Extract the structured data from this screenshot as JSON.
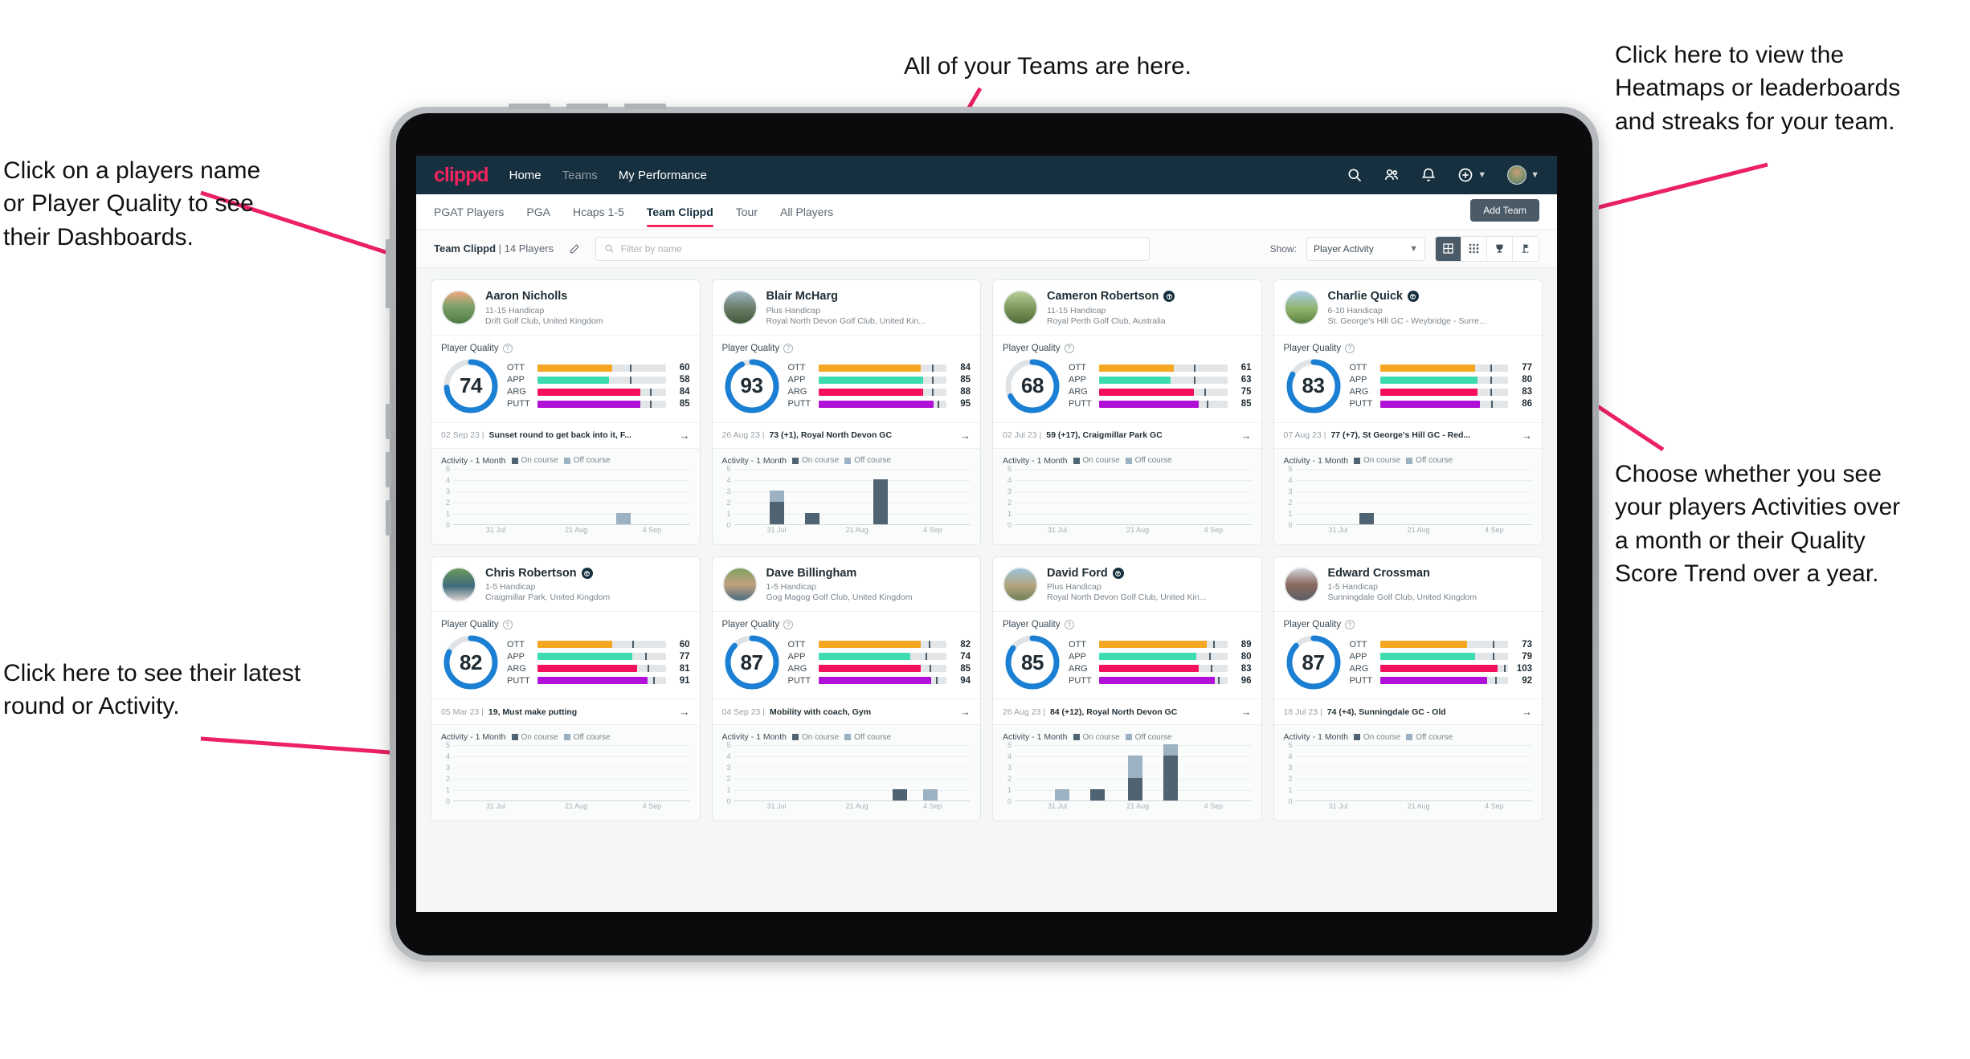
{
  "annotations": [
    {
      "id": "teams",
      "text": "All of your Teams are here."
    },
    {
      "id": "heatmaps",
      "text": "Click here to view the\nHeatmaps or leaderboards\nand streaks for your team."
    },
    {
      "id": "player-name",
      "text": "Click on a players name\nor Player Quality to see\ntheir Dashboards."
    },
    {
      "id": "show-toggle",
      "text": "Choose whether you see\nyour players Activities over\na month or their Quality\nScore Trend over a year."
    },
    {
      "id": "latest-round",
      "text": "Click here to see their latest\nround or Activity."
    }
  ],
  "colors": {
    "brand_pink": "#f0245f",
    "nav_dark": "#16303f",
    "ott": "#f5a623",
    "app": "#3ddbb0",
    "arg": "#f5105e",
    "putt": "#b110d6",
    "donut": "#1b7fd4",
    "donut_track": "#dfe3e6",
    "on_course": "#4f6373",
    "off_course": "#9cb1c2"
  },
  "topnav": {
    "logo": "clippd",
    "links": [
      {
        "label": "Home",
        "active": true
      },
      {
        "label": "Teams",
        "active": false
      },
      {
        "label": "My Performance",
        "active": true
      }
    ],
    "icons": [
      "search-icon",
      "people-icon",
      "bell-icon",
      "plus-circle-icon",
      "avatar"
    ]
  },
  "tabs": [
    {
      "label": "PGAT Players",
      "active": false
    },
    {
      "label": "PGA",
      "active": false
    },
    {
      "label": "Hcaps 1-5",
      "active": false
    },
    {
      "label": "Team Clippd",
      "active": true
    },
    {
      "label": "Tour",
      "active": false
    },
    {
      "label": "All Players",
      "active": false
    }
  ],
  "add_team_label": "Add Team",
  "filterbar": {
    "team_name": "Team Clippd",
    "player_count": "| 14 Players",
    "edit_icon": "pencil-icon",
    "search_placeholder": "Filter by name",
    "search_value": "",
    "show_label": "Show:",
    "show_value": "Player Activity",
    "show_options": [
      "Player Activity",
      "Quality Score Trend"
    ],
    "view_buttons": [
      {
        "name": "grid-view",
        "active": true
      },
      {
        "name": "dense-grid-view",
        "active": false
      },
      {
        "name": "leaderboard-trophy-view",
        "active": false
      },
      {
        "name": "streaks-flag-view",
        "active": false
      }
    ]
  },
  "card_labels": {
    "player_quality": "Player Quality",
    "activity": "Activity - 1 Month",
    "legend_on": "On course",
    "legend_off": "Off course",
    "metric_names": [
      "OTT",
      "APP",
      "ARG",
      "PUTT"
    ]
  },
  "chart_data": {
    "type": "bar",
    "title": "Activity - 1 Month",
    "ylabel": "",
    "xlabel": "",
    "ylim": [
      0,
      5
    ],
    "yticks": [
      0,
      1,
      2,
      3,
      4,
      5
    ],
    "xticks": [
      "31 Jul",
      "21 Aug",
      "4 Sep"
    ],
    "grid": true,
    "legend": [
      "On course",
      "Off course"
    ],
    "stacked": true
  },
  "players": [
    {
      "name": "Aaron Nicholls",
      "verified": false,
      "handicap": "11-15 Handicap",
      "club": "Drift Golf Club, United Kingdom",
      "avatar_css": "linear-gradient(180deg,#f0a884 0%,#7fa36a 45%,#4e7a45 100%)",
      "quality": 74,
      "metrics": [
        {
          "key": "OTT",
          "value": 60,
          "fill": 58,
          "tick": 72
        },
        {
          "key": "APP",
          "value": 58,
          "fill": 56,
          "tick": 72
        },
        {
          "key": "ARG",
          "value": 84,
          "fill": 80,
          "tick": 88
        },
        {
          "key": "PUTT",
          "value": 85,
          "fill": 80,
          "tick": 88
        }
      ],
      "round_date": "02 Sep 23 |",
      "round_text": "Sunset round to get back into it, F...",
      "activity": [
        {
          "x": 0.72,
          "on": 0,
          "off": 1
        }
      ]
    },
    {
      "name": "Blair McHarg",
      "verified": false,
      "handicap": "Plus Handicap",
      "club": "Royal North Devon Golf Club, United Kin...",
      "avatar_css": "linear-gradient(180deg,#9fb6c6 0%,#6d7f6a 50%,#3f5a3a 100%)",
      "quality": 93,
      "metrics": [
        {
          "key": "OTT",
          "value": 84,
          "fill": 80,
          "tick": 89
        },
        {
          "key": "APP",
          "value": 85,
          "fill": 82,
          "tick": 89
        },
        {
          "key": "ARG",
          "value": 88,
          "fill": 82,
          "tick": 89
        },
        {
          "key": "PUTT",
          "value": 95,
          "fill": 90,
          "tick": 93
        }
      ],
      "round_date": "26 Aug 23 |",
      "round_text": "73 (+1), Royal North Devon GC",
      "activity": [
        {
          "x": 0.18,
          "on": 2,
          "off": 1
        },
        {
          "x": 0.33,
          "on": 1,
          "off": 0
        },
        {
          "x": 0.62,
          "on": 4,
          "off": 0
        }
      ]
    },
    {
      "name": "Cameron Robertson",
      "verified": true,
      "handicap": "11-15 Handicap",
      "club": "Royal Perth Golf Club, Australia",
      "avatar_css": "linear-gradient(180deg,#b9cf9a 0%,#7e9a5c 50%,#4f6b3a 100%)",
      "quality": 68,
      "metrics": [
        {
          "key": "OTT",
          "value": 61,
          "fill": 58,
          "tick": 74
        },
        {
          "key": "APP",
          "value": 63,
          "fill": 56,
          "tick": 74
        },
        {
          "key": "ARG",
          "value": 75,
          "fill": 74,
          "tick": 82
        },
        {
          "key": "PUTT",
          "value": 85,
          "fill": 78,
          "tick": 84
        }
      ],
      "round_date": "02 Jul 23 |",
      "round_text": "59 (+17), Craigmillar Park GC",
      "activity": []
    },
    {
      "name": "Charlie Quick",
      "verified": true,
      "handicap": "6-10 Handicap",
      "club": "St. George's Hill GC - Weybridge - Surrey, ...",
      "avatar_css": "linear-gradient(180deg,#a9cbe8 0%,#8fb36c 55%,#5c7f42 100%)",
      "quality": 83,
      "metrics": [
        {
          "key": "OTT",
          "value": 77,
          "fill": 74,
          "tick": 86
        },
        {
          "key": "APP",
          "value": 80,
          "fill": 76,
          "tick": 86
        },
        {
          "key": "ARG",
          "value": 83,
          "fill": 76,
          "tick": 86
        },
        {
          "key": "PUTT",
          "value": 86,
          "fill": 78,
          "tick": 87
        }
      ],
      "round_date": "07 Aug 23 |",
      "round_text": "77 (+7), St George's Hill GC - Red...",
      "activity": [
        {
          "x": 0.3,
          "on": 1,
          "off": 0
        }
      ]
    },
    {
      "name": "Chris Robertson",
      "verified": true,
      "handicap": "1-5 Handicap",
      "club": "Craigmillar Park, United Kingdom",
      "avatar_css": "linear-gradient(180deg,#6c9b5a 0%,#3f6a7e 55%,#d8d2cc 100%)",
      "quality": 82,
      "metrics": [
        {
          "key": "OTT",
          "value": 60,
          "fill": 58,
          "tick": 74
        },
        {
          "key": "APP",
          "value": 77,
          "fill": 74,
          "tick": 84
        },
        {
          "key": "ARG",
          "value": 81,
          "fill": 78,
          "tick": 86
        },
        {
          "key": "PUTT",
          "value": 91,
          "fill": 86,
          "tick": 90
        }
      ],
      "round_date": "05 Mar 23 |",
      "round_text": "19, Must make putting",
      "activity": []
    },
    {
      "name": "Dave Billingham",
      "verified": false,
      "handicap": "1-5 Handicap",
      "club": "Gog Magog Golf Club, United Kingdom",
      "avatar_css": "linear-gradient(180deg,#7fa05f 0%,#c2a27e 50%,#4a6b80 100%)",
      "quality": 87,
      "metrics": [
        {
          "key": "OTT",
          "value": 82,
          "fill": 80,
          "tick": 86
        },
        {
          "key": "APP",
          "value": 74,
          "fill": 72,
          "tick": 84
        },
        {
          "key": "ARG",
          "value": 85,
          "fill": 80,
          "tick": 87
        },
        {
          "key": "PUTT",
          "value": 94,
          "fill": 88,
          "tick": 92
        }
      ],
      "round_date": "04 Sep 23 |",
      "round_text": "Mobility with coach, Gym",
      "activity": [
        {
          "x": 0.7,
          "on": 1,
          "off": 0
        },
        {
          "x": 0.83,
          "on": 0,
          "off": 1
        }
      ]
    },
    {
      "name": "David Ford",
      "verified": true,
      "handicap": "Plus Handicap",
      "club": "Royal North Devon Golf Club, United Kin...",
      "avatar_css": "linear-gradient(180deg,#9ec3d8 0%,#b2a37c 55%,#6e7f58 100%)",
      "quality": 85,
      "metrics": [
        {
          "key": "OTT",
          "value": 89,
          "fill": 84,
          "tick": 89
        },
        {
          "key": "APP",
          "value": 80,
          "fill": 76,
          "tick": 86
        },
        {
          "key": "ARG",
          "value": 83,
          "fill": 78,
          "tick": 87
        },
        {
          "key": "PUTT",
          "value": 96,
          "fill": 90,
          "tick": 93
        }
      ],
      "round_date": "26 Aug 23 |",
      "round_text": "84 (+12), Royal North Devon GC",
      "activity": [
        {
          "x": 0.2,
          "on": 0,
          "off": 1
        },
        {
          "x": 0.35,
          "on": 1,
          "off": 0
        },
        {
          "x": 0.51,
          "on": 2,
          "off": 2
        },
        {
          "x": 0.66,
          "on": 4,
          "off": 1
        }
      ]
    },
    {
      "name": "Edward Crossman",
      "verified": false,
      "handicap": "1-5 Handicap",
      "club": "Sunningdale Golf Club, United Kingdom",
      "avatar_css": "linear-gradient(180deg,#cfd4d8 0%,#8d6a60 50%,#5a5f63 100%)",
      "quality": 87,
      "metrics": [
        {
          "key": "OTT",
          "value": 73,
          "fill": 68,
          "tick": 88
        },
        {
          "key": "APP",
          "value": 79,
          "fill": 74,
          "tick": 88
        },
        {
          "key": "ARG",
          "value": 103,
          "fill": 92,
          "tick": 97
        },
        {
          "key": "PUTT",
          "value": 92,
          "fill": 84,
          "tick": 90
        }
      ],
      "round_date": "18 Jul 23 |",
      "round_text": "74 (+4), Sunningdale GC - Old",
      "activity": []
    }
  ]
}
